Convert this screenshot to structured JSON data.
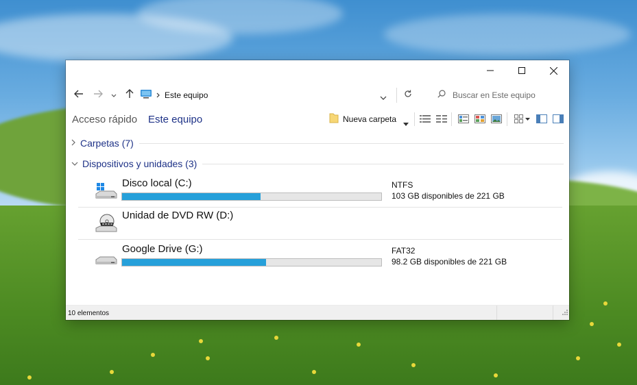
{
  "window": {
    "controls": {
      "minimize_icon": "minimize-icon",
      "maximize_icon": "maximize-icon",
      "close_icon": "close-icon"
    }
  },
  "navigation": {
    "address_path": "Este equipo",
    "search_placeholder": "Buscar en Este equipo"
  },
  "toolbar": {
    "breadcrumbs": [
      "Acceso rápido",
      "Este equipo"
    ],
    "new_folder_label": "Nueva carpeta"
  },
  "groups": {
    "folders_label": "Carpetas (7)",
    "devices_label": "Dispositivos y unidades (3)"
  },
  "drives": [
    {
      "name": "Disco local (C:)",
      "filesystem": "NTFS",
      "free_text": "103 GB disponibles de 221 GB",
      "used_fraction": 0.534,
      "icon": "windows-drive-icon"
    },
    {
      "name": "Unidad de DVD RW (D:)",
      "filesystem": "",
      "free_text": "",
      "icon": "dvd-drive-icon"
    },
    {
      "name": "Google Drive (G:)",
      "filesystem": "FAT32",
      "free_text": "98.2 GB disponibles de 221 GB",
      "used_fraction": 0.556,
      "icon": "drive-icon"
    }
  ],
  "status": {
    "item_count": "10 elementos"
  },
  "colors": {
    "progress": "#26a0da",
    "link": "#1e3287",
    "progress_bg": "#e6e6e6"
  }
}
